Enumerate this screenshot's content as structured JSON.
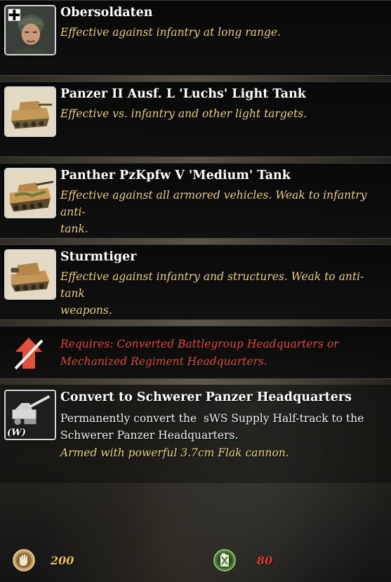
{
  "units": [
    {
      "title": "Obersoldaten",
      "desc": "Effective against infantry at long range.",
      "icon": "obersoldaten-portrait"
    },
    {
      "title": "Panzer II Ausf. L 'Luchs' Light Tank",
      "desc": "Effective vs. infantry and other light targets.",
      "icon": "luchs-tank-portrait"
    },
    {
      "title": "Panther PzKpfw V 'Medium' Tank",
      "desc_line1": "Effective against all armored vehicles. Weak to infantry anti-",
      "desc_line2": "tank.",
      "icon": "panther-tank-portrait"
    },
    {
      "title": "Sturmtiger",
      "desc_line1": "Effective against infantry and structures. Weak to anti-tank",
      "desc_line2": "weapons.",
      "icon": "sturmtiger-portrait"
    }
  ],
  "requirement": {
    "line1": "Requires: Converted Battlegroup Headquarters or",
    "line2": "Mechanized Regiment Headquarters.",
    "icon": "locked-upgrade-icon",
    "color": "#e24a3a"
  },
  "upgrade": {
    "title": "Convert to Schwerer Panzer Headquarters",
    "desc_line1": "Permanently convert the  sWS Supply Half-track to the",
    "desc_line2": "Schwerer Panzer Headquarters.",
    "note": "Armed with powerful 3.7cm Flak cannon.",
    "hotkey": "(W)",
    "icon": "flak-halftrack-icon"
  },
  "costs": {
    "manpower": {
      "value": "200",
      "icon": "manpower-icon",
      "color": "#e8c44a"
    },
    "fuel": {
      "value": "80",
      "icon": "fuel-icon",
      "color": "#e03a2a"
    }
  }
}
